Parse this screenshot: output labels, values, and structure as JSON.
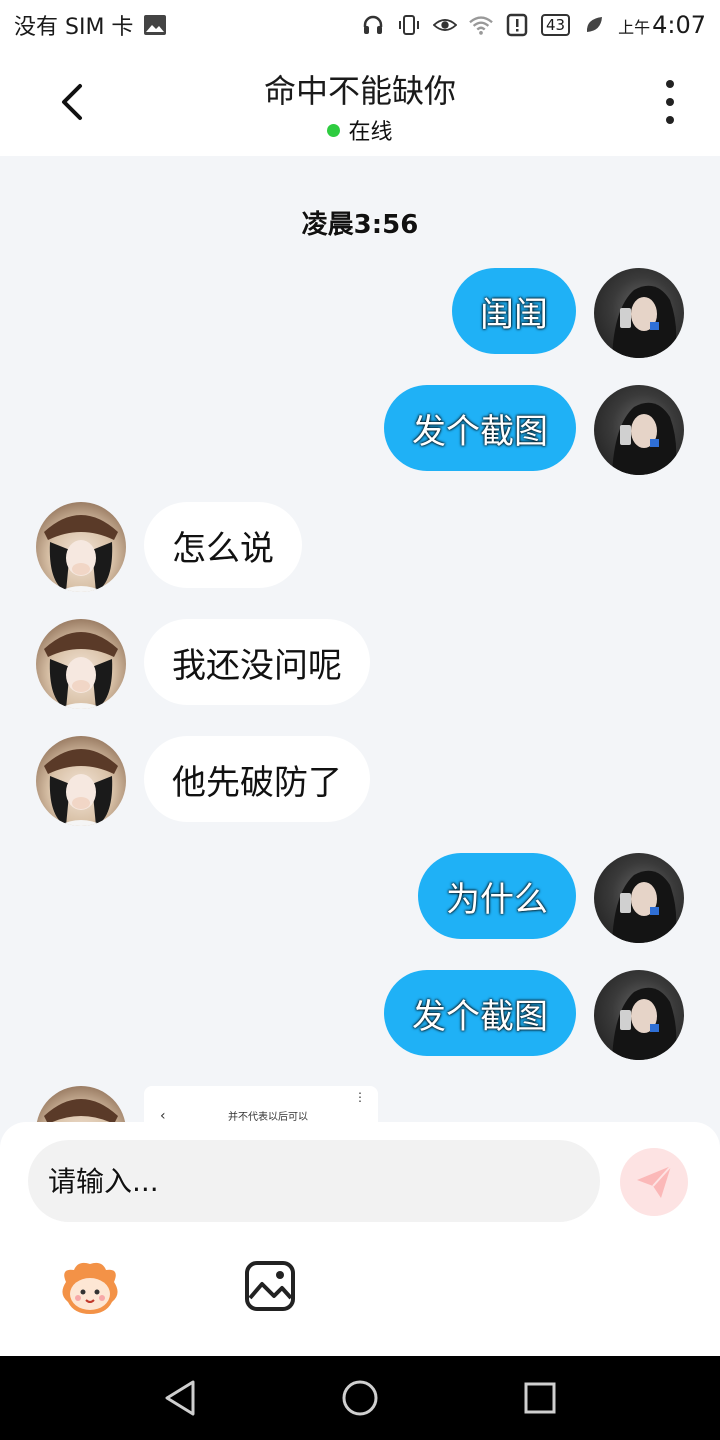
{
  "status_bar": {
    "carrier": "没有 SIM 卡",
    "battery": "43",
    "time_prefix": "上午",
    "time": "4:07"
  },
  "header": {
    "title": "命中不能缺你",
    "status": "在线",
    "status_color": "#2ecc40"
  },
  "chat": {
    "timestamp": "凌晨3:56",
    "messages": [
      {
        "direction": "out",
        "text": "闺闺"
      },
      {
        "direction": "out",
        "text": "发个截图"
      },
      {
        "direction": "in",
        "text": "怎么说"
      },
      {
        "direction": "in",
        "text": "我还没问呢"
      },
      {
        "direction": "in",
        "text": "他先破防了"
      },
      {
        "direction": "out",
        "text": "为什么"
      },
      {
        "direction": "out",
        "text": "发个截图"
      }
    ],
    "image_preview_text": "并不代表以后可以"
  },
  "input": {
    "placeholder": "请输入..."
  },
  "colors": {
    "outgoing_bubble": "#1fb1f6",
    "incoming_bubble": "#ffffff",
    "background": "#f3f5f8",
    "send_button": "#fde3e3"
  }
}
